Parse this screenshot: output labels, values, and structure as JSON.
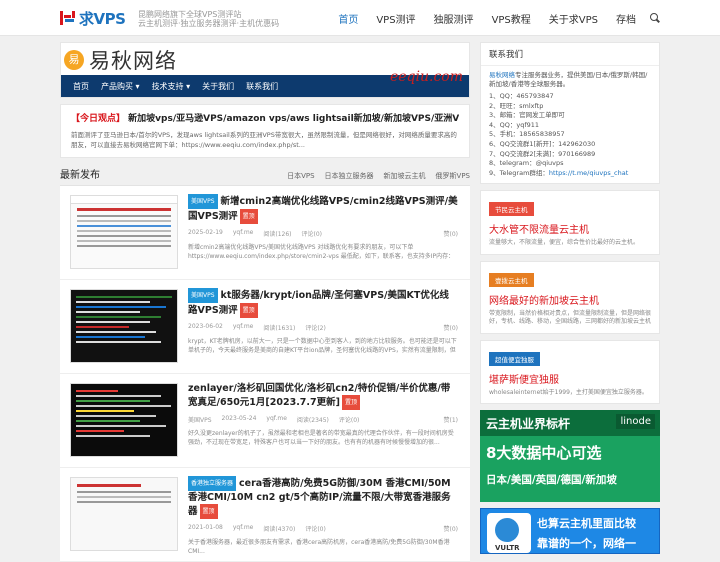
{
  "header": {
    "logo_text": "求VPS",
    "slogan_line1": "昆鹏网络旗下全球VPS测评站",
    "slogan_line2": "云主机测评·独立服务器测评·主机优惠码",
    "nav": [
      "首页",
      "VPS测评",
      "独服测评",
      "VPS教程",
      "关于求VPS",
      "存档"
    ],
    "active_index": 0
  },
  "banner": {
    "circle_char": "易",
    "site_name": "易秋网络",
    "menu": [
      "首页",
      "产品购买 ▾",
      "技术支持 ▾",
      "关于我们",
      "联系我们"
    ],
    "watermark": "eeqiu.com"
  },
  "notice": {
    "tag": "【今日观点】",
    "title": "新加坡vps/亚马逊VPS/amazon vps/aws lightsail新加坡/新加坡VPS/亚洲VPS/VPS测评",
    "body": "前面测评了亚马逊日本/首尔的VPS，发现aws lightsail系列的亚洲VPS带宽很大，虽然限制流量，但是网络很好，对网络质量要求高的朋友，可以直接去易秋网络官网下单：https://www.eeqiu.com/index.php/st..."
  },
  "latest": {
    "heading": "最新发布",
    "filters": [
      "日本VPS",
      "日本独立服务器",
      "新加坡云主机",
      "俄罗斯VPS"
    ]
  },
  "posts": [
    {
      "category": "美国VPS",
      "title": "新增cmin2高端优化线路VPS/cmin2线路VPS测评/美国VPS测评",
      "pinned": "置顶",
      "date": "2025-02-19",
      "author": "yqf.me",
      "views": "阅读(126)",
      "comments": "评论(0)",
      "likes": "赞(0)",
      "excerpt": "新增cmin2高端优化线路VPS/美国优化线路VPS 对线路优化有要求的朋友，可以下单 https://www.eeqiu.com/index.php/store/cmin2-vps 最低配，如下，联系客，也支持多IP内存：4..."
    },
    {
      "category": "美国VPS",
      "title": "kt服务器/krypt/ion品牌/圣何塞VPS/美国KT优化线路VPS测评",
      "pinned": "置顶",
      "date": "2023-06-02",
      "author": "yqf.me",
      "views": "阅读(1631)",
      "comments": "评论(2)",
      "likes": "赞(0)",
      "excerpt": "krypt，KT老牌机房，以前大一，只是一个数据中心型到客人，到的地方比较服务。也可能还是可以下单机子的，今天最终服务是美商的自建KT平台ion品牌，圣何塞优化线路的VPS，实然有流量限制，但是网络还是很好，而且稳定，..."
    },
    {
      "category": "美国VPS",
      "title": "zenlayer/洛杉矶回国优化/洛杉矶cn2/特价促销/半价优惠/带宽真足/650元1月[2023.7.7更新]",
      "pinned": "置顶",
      "date": "2023-05-24",
      "author": "yqf.me",
      "views": "阅读(2345)",
      "comments": "评论(0)",
      "likes": "赞(1)",
      "excerpt": "好久没更zenlayer的机子了，虽然最和老相也是著名的带宽最真的代理合作伙伴，有一段时间机房受强劲，不过现在带宽足，特殊客户也可以当一下好的朋友。也有有的机器有时候慢慢增加的很..."
    },
    {
      "category": "香港独立服务器",
      "title": "cera香港高防/免费5G防御/30M 香港CMI/50M香港CMI/10M cn2 gt/5个高防IP/流量不限/大带宽香港服务器",
      "pinned": "置顶",
      "date": "2021-01-08",
      "author": "yqf.me",
      "views": "阅读(4370)",
      "comments": "评论(0)",
      "likes": "赞(0)",
      "excerpt": "关于香港服务器，最近很多朋友有需求，香港cera高防机房，cera香港高防/免费5G防御/30M香港CMI..."
    }
  ],
  "sidebar": {
    "contact_heading": "联系我们",
    "contact_intro_brand": "易秋网络",
    "contact_intro_rest": "专注服务器业务，提供美国/日本/俄罗斯/韩国/新加坡/香港等全球服务器。",
    "contacts": [
      "1、QQ：465793847",
      "2、旺旺：smlxftp",
      "3、邮箱：官网发工单即可",
      "4、QQ：yqf911",
      "5、手机：18565838957",
      "6、QQ交流群1[新开]：142962030",
      "7、QQ交流群2[未满]：970166989",
      "8、telegram：@qiuvps"
    ],
    "telegram_group_label": "9、Telegram群组：",
    "telegram_group_link": "https://t.me/qiuvps_chat",
    "promos": [
      {
        "label": "节民云主机",
        "label_color": "#e74c3c",
        "title": "大水管不限流量云主机",
        "desc": "流量够大，不限流量，便宜，综合性价比最好的云主机。"
      },
      {
        "label": "壹拨云主机",
        "label_color": "#e67e22",
        "title": "网络最好的新加坡云主机",
        "desc": "带宽限制，当然价格相对贵点，但流量限制流量，但是网络很好，专机、线路、移动，全国线路，三网都好的新加坡云主机"
      },
      {
        "label": "超值便宜独服",
        "label_color": "#1e73be",
        "title": "堪萨斯便宜独服",
        "desc": "wholesaleinternet始于1999，主打美国便宜独立服务器。"
      }
    ],
    "ad1": {
      "top_left": "云主机业界标杆",
      "top_right": "linode",
      "middle": "8大数据中心可选",
      "bottom": "日本/美国/英国/德国/新加坡"
    },
    "ad2": {
      "brand": "VULTR",
      "line1": "也算云主机里面比较",
      "line2": "靠谱的一个，网络一"
    }
  }
}
